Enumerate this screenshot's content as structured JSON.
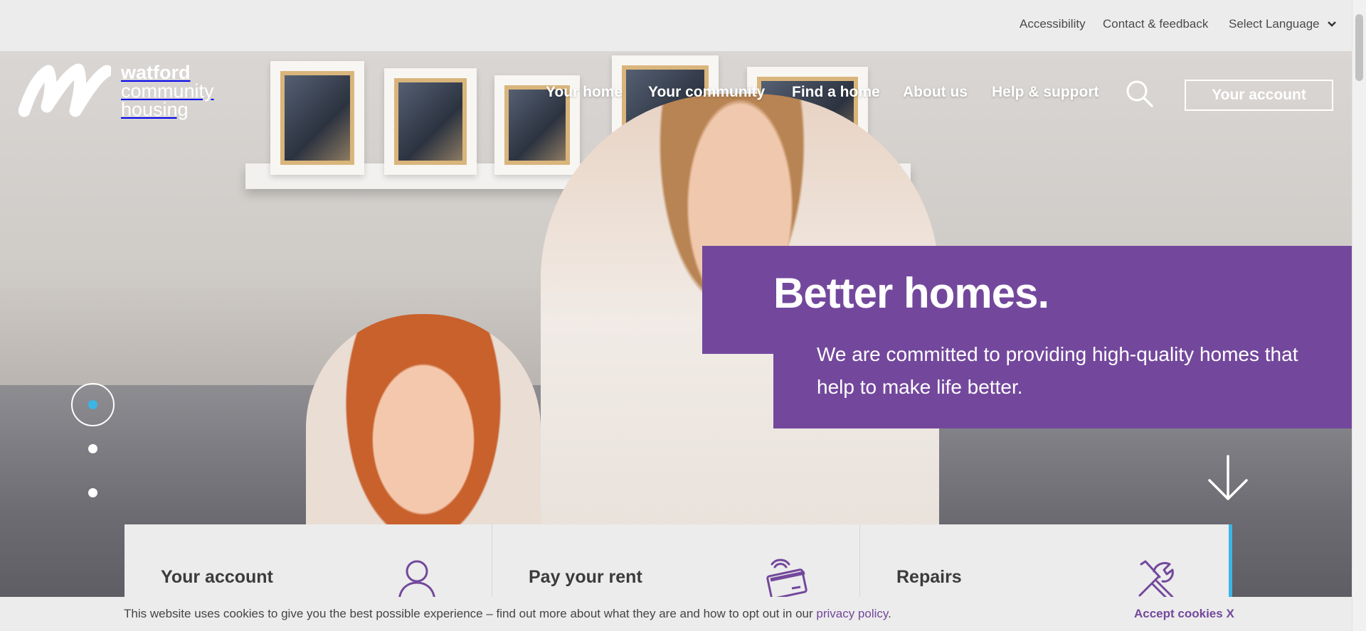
{
  "utility_nav": {
    "accessibility": "Accessibility",
    "contact": "Contact & feedback",
    "language": "Select Language"
  },
  "logo": {
    "line1": "watford",
    "line2": "community",
    "line3": "housing"
  },
  "main_nav": {
    "items": [
      {
        "label": "Your home"
      },
      {
        "label": "Your community"
      },
      {
        "label": "Find a home"
      },
      {
        "label": "About us"
      },
      {
        "label": "Help & support"
      }
    ],
    "account_label": "Your account"
  },
  "hero": {
    "title": "Better homes.",
    "text": "We are committed to providing high-quality homes that help to make life better.",
    "slide_count": 3,
    "active_slide": 1
  },
  "quick_links": [
    {
      "label": "Your account",
      "icon": "user-icon"
    },
    {
      "label": "Pay your rent",
      "icon": "contactless-card-icon"
    },
    {
      "label": "Repairs",
      "icon": "tools-icon"
    }
  ],
  "cookie_bar": {
    "message": "This website uses cookies to give you the best possible experience – find out more about what they are and how to opt out in our ",
    "link_text": "privacy policy",
    "end": ".",
    "accept_label": "Accept cookies X"
  },
  "colors": {
    "brand_purple": "#73489c",
    "accent_blue": "#3ab5e6",
    "bar_grey": "#ececec"
  }
}
